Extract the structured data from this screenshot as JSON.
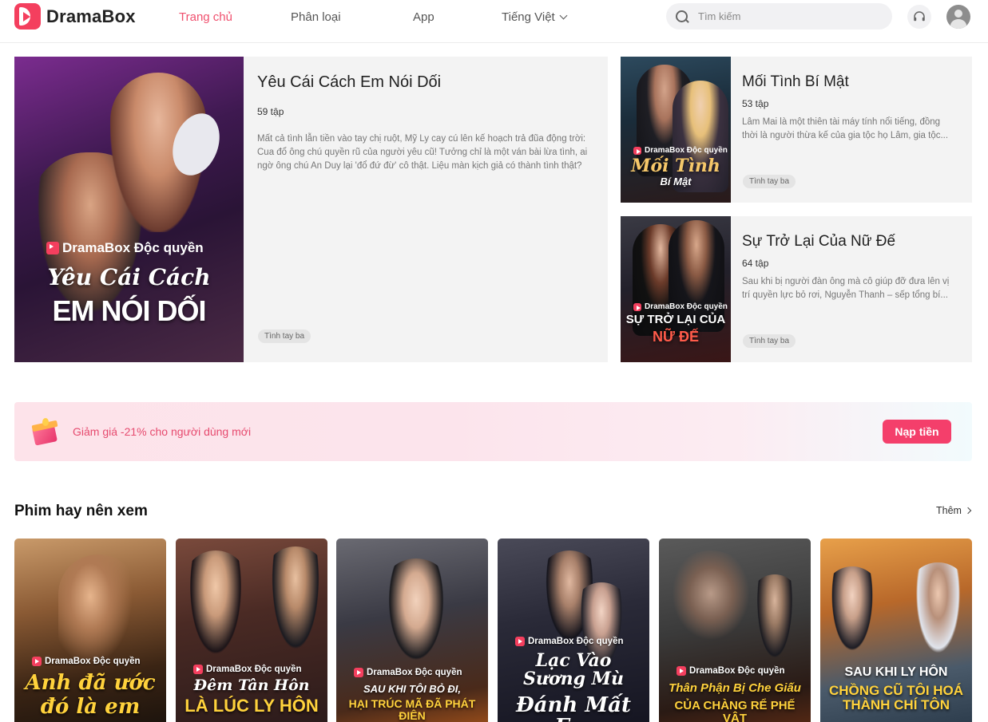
{
  "header": {
    "logo_text": "DramaBox",
    "nav": {
      "home": "Trang chủ",
      "category": "Phân loại",
      "app": "App",
      "language": "Tiếng Việt"
    },
    "search_placeholder": "Tìm kiếm",
    "accent_color": "#f0506e"
  },
  "featured": {
    "main": {
      "title": "Yêu Cái Cách Em Nói Dối",
      "episodes": "59 tập",
      "description": "Mất cả tình lẫn tiền vào tay chị ruột, Mỹ Ly cay cú lên kế hoạch trả đũa động trời: Cua đổ ông chú quyền rũ của người yêu cũ! Tưởng chỉ là một ván bài lừa tình, ai ngờ ông chú An Duy lại 'đổ đứ đừ' cô thật. Liệu màn kịch giả có thành tình thật?",
      "tag": "Tình tay ba",
      "poster_brand": "DramaBox Độc quyền",
      "poster_title_line1": "Yêu Cái Cách",
      "poster_title_line2": "EM NÓI DỐI"
    },
    "side": [
      {
        "title": "Mối Tình Bí Mật",
        "episodes": "53 tập",
        "description": "Lâm Mai là một thiên tài máy tính nổi tiếng, đồng thời là người thừa kế của gia tộc họ Lâm, gia tộc...",
        "tag": "Tình tay ba",
        "poster_brand": "DramaBox Độc quyền",
        "poster_title_line1": "Mối Tình",
        "poster_title_line2": "Bí Mật"
      },
      {
        "title": "Sự Trở Lại Của Nữ Đế",
        "episodes": "64 tập",
        "description": "Sau khi bị người đàn ông mà cô giúp đỡ đưa lên vị trí quyền lực bỏ rơi, Nguyễn Thanh – sếp tổng bí...",
        "tag": "Tình tay ba",
        "poster_brand": "DramaBox Độc quyền",
        "poster_title_line1": "SỰ TRỞ LẠI CỦA",
        "poster_title_line2": "NỮ ĐẾ"
      }
    ]
  },
  "promo": {
    "text": "Giảm giá -21% cho người dùng mới",
    "button_label": "Nạp tiền"
  },
  "section": {
    "title": "Phim hay nên xem",
    "more_label": "Thêm",
    "cards": [
      {
        "brand": "DramaBox Độc quyền",
        "title_line1": "Anh đã ước",
        "title_line2": "đó là em"
      },
      {
        "brand": "DramaBox Độc quyền",
        "title_line1": "Đêm Tân Hôn",
        "title_line2": "LÀ LÚC LY HÔN"
      },
      {
        "brand": "DramaBox Độc quyền",
        "title_line1": "SAU KHI TÔI BỎ ĐI,",
        "title_line2": "HẠI TRÚC MÃ ĐÃ PHÁT ĐIÊN"
      },
      {
        "brand": "DramaBox Độc quyền",
        "title_line1": "Lạc Vào Sương Mù",
        "title_line2": "Đánh Mất Em"
      },
      {
        "brand": "DramaBox Độc quyền",
        "title_line1": "Thân Phận Bị Che Giấu",
        "title_line2": "CỦA CHÀNG RỂ PHẾ VẬT"
      },
      {
        "brand": "",
        "title_line1": "SAU KHI LY HÔN",
        "title_line2": "CHỒNG CŨ TÔI HOÁ THÀNH CHÍ TÔN"
      }
    ]
  }
}
